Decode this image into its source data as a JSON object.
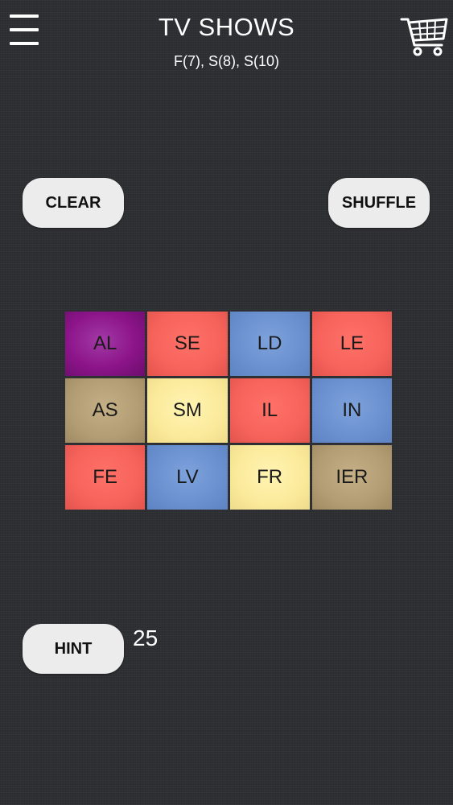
{
  "header": {
    "title": "TV SHOWS",
    "subtitle": "F(7), S(8), S(10)",
    "menu_icon": "hamburger-menu-icon",
    "cart_icon": "shopping-cart-icon"
  },
  "controls": {
    "clear_label": "CLEAR",
    "shuffle_label": "SHUFFLE",
    "hint_label": "HINT",
    "hint_count": "25"
  },
  "colors": {
    "magenta": "#8c1489",
    "red": "#f6635b",
    "blue": "#6a90cf",
    "tan": "#b39d74",
    "yellow": "#fbea9b",
    "background": "#2e2f33"
  },
  "tiles": [
    {
      "text": "AL",
      "color": "magenta"
    },
    {
      "text": "SE",
      "color": "red"
    },
    {
      "text": "LD",
      "color": "blue"
    },
    {
      "text": "LE",
      "color": "red"
    },
    {
      "text": "AS",
      "color": "tan"
    },
    {
      "text": "SM",
      "color": "yellow"
    },
    {
      "text": "IL",
      "color": "red"
    },
    {
      "text": "IN",
      "color": "blue"
    },
    {
      "text": "FE",
      "color": "red"
    },
    {
      "text": "LV",
      "color": "blue"
    },
    {
      "text": "FR",
      "color": "yellow"
    },
    {
      "text": "IER",
      "color": "tan"
    }
  ]
}
